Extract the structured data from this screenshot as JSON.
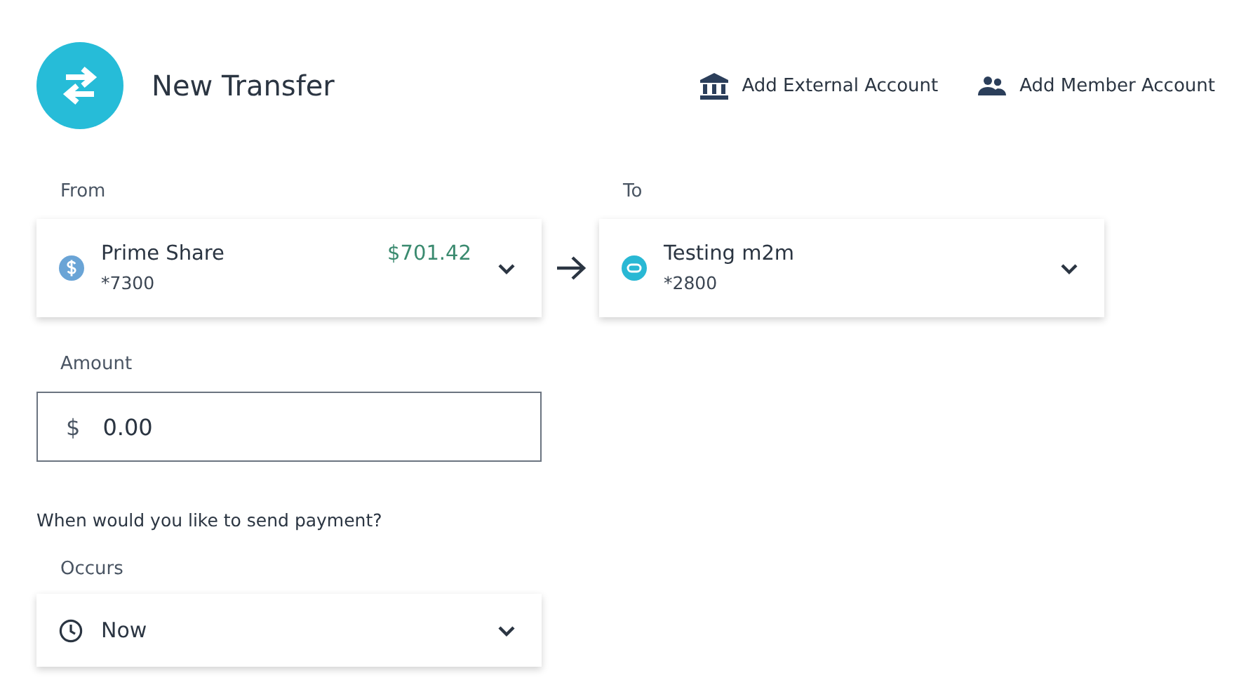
{
  "header": {
    "title": "New Transfer"
  },
  "actions": [
    {
      "kind": "bank",
      "label": "Add External Account"
    },
    {
      "kind": "members",
      "label": "Add Member Account"
    }
  ],
  "from": {
    "label": "From",
    "account": {
      "name": "Prime Share",
      "number": "*7300",
      "balance": "$701.42"
    }
  },
  "to": {
    "label": "To",
    "account": {
      "name": "Testing m2m",
      "number": "*2800"
    }
  },
  "amount": {
    "label": "Amount",
    "currency": "$",
    "value": "0.00"
  },
  "schedule": {
    "question": "When would you like to send payment?",
    "label": "Occurs",
    "value": "Now"
  }
}
